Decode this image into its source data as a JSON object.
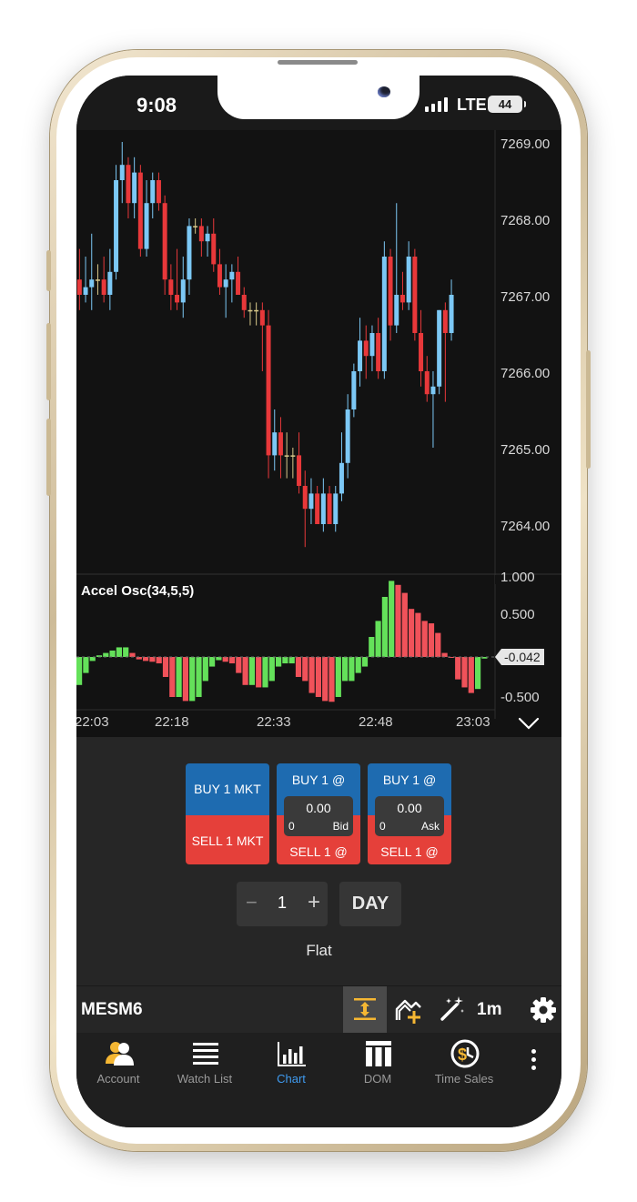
{
  "status_bar": {
    "time": "9:08",
    "network": "LTE",
    "battery": "44"
  },
  "chart": {
    "price_labels": [
      "7269.00",
      "7268.00",
      "7267.00",
      "7266.00",
      "7265.00",
      "7264.00"
    ],
    "oscillator": {
      "title": "Accel Osc(34,5,5)",
      "labels": [
        "1.000",
        "0.500",
        "-0.500"
      ],
      "current_value": "-0.042"
    },
    "time_labels": [
      "22:03",
      "22:18",
      "22:33",
      "22:48",
      "23:03"
    ],
    "colors": {
      "up": "#7cc8f5",
      "down": "#e8383a",
      "doji": "#d9c98a",
      "osc_up": "#64e15a",
      "osc_down": "#f0525a"
    },
    "chart_data": {
      "type": "candlestick",
      "title": "",
      "ylim": [
        7263.5,
        7269.2
      ],
      "candles": [
        [
          7267.2,
          7267.6,
          7266.8,
          7267.0
        ],
        [
          7267.0,
          7267.5,
          7266.9,
          7267.1
        ],
        [
          7267.1,
          7267.8,
          7266.8,
          7267.2
        ],
        [
          7267.2,
          7267.4,
          7267.0,
          7267.2
        ],
        [
          7267.2,
          7267.5,
          7266.9,
          7267.0
        ],
        [
          7267.0,
          7267.6,
          7266.8,
          7267.3
        ],
        [
          7267.3,
          7268.7,
          7267.2,
          7268.5
        ],
        [
          7268.5,
          7269.0,
          7268.2,
          7268.7
        ],
        [
          7268.7,
          7268.8,
          7268.0,
          7268.2
        ],
        [
          7268.2,
          7268.8,
          7268.0,
          7268.6
        ],
        [
          7268.6,
          7268.7,
          7267.5,
          7267.6
        ],
        [
          7267.6,
          7268.5,
          7267.5,
          7268.2
        ],
        [
          7268.2,
          7268.6,
          7268.0,
          7268.5
        ],
        [
          7268.5,
          7268.6,
          7268.1,
          7268.2
        ],
        [
          7268.2,
          7268.3,
          7267.0,
          7267.2
        ],
        [
          7267.2,
          7267.4,
          7266.8,
          7267.0
        ],
        [
          7267.0,
          7267.6,
          7266.8,
          7266.9
        ],
        [
          7266.9,
          7267.5,
          7266.7,
          7267.2
        ],
        [
          7267.2,
          7268.0,
          7267.0,
          7267.9
        ],
        [
          7267.9,
          7268.0,
          7267.8,
          7267.9
        ],
        [
          7267.9,
          7268.0,
          7267.5,
          7267.7
        ],
        [
          7267.7,
          7267.9,
          7267.5,
          7267.8
        ],
        [
          7267.8,
          7268.0,
          7267.3,
          7267.4
        ],
        [
          7267.4,
          7267.6,
          7267.0,
          7267.1
        ],
        [
          7267.1,
          7267.4,
          7266.7,
          7267.2
        ],
        [
          7267.2,
          7267.4,
          7266.9,
          7267.3
        ],
        [
          7267.3,
          7267.5,
          7267.0,
          7267.0
        ],
        [
          7267.0,
          7267.1,
          7266.7,
          7266.8
        ],
        [
          7266.8,
          7266.9,
          7266.6,
          7266.8
        ],
        [
          7266.8,
          7266.9,
          7266.6,
          7266.8
        ],
        [
          7266.8,
          7266.9,
          7266.0,
          7266.6
        ],
        [
          7266.6,
          7266.8,
          7264.6,
          7264.9
        ],
        [
          7264.9,
          7265.5,
          7264.7,
          7265.2
        ],
        [
          7265.2,
          7265.4,
          7264.6,
          7264.9
        ],
        [
          7264.9,
          7265.2,
          7264.6,
          7264.9
        ],
        [
          7264.9,
          7265.0,
          7264.6,
          7264.9
        ],
        [
          7264.9,
          7265.2,
          7264.4,
          7264.5
        ],
        [
          7264.5,
          7264.7,
          7263.7,
          7264.2
        ],
        [
          7264.2,
          7264.6,
          7264.0,
          7264.4
        ],
        [
          7264.4,
          7264.5,
          7264.0,
          7264.0
        ],
        [
          7264.0,
          7264.6,
          7263.9,
          7264.4
        ],
        [
          7264.4,
          7264.5,
          7264.0,
          7264.0
        ],
        [
          7264.0,
          7264.5,
          7263.9,
          7264.4
        ],
        [
          7264.4,
          7265.2,
          7264.3,
          7264.8
        ],
        [
          7264.8,
          7265.7,
          7264.6,
          7265.5
        ],
        [
          7265.5,
          7266.1,
          7265.4,
          7266.0
        ],
        [
          7266.0,
          7266.7,
          7265.8,
          7266.4
        ],
        [
          7266.4,
          7266.6,
          7265.9,
          7266.2
        ],
        [
          7266.2,
          7266.6,
          7266.0,
          7266.5
        ],
        [
          7266.5,
          7266.7,
          7265.9,
          7266.0
        ],
        [
          7266.0,
          7267.7,
          7265.9,
          7267.5
        ],
        [
          7267.5,
          7267.6,
          7266.4,
          7266.6
        ],
        [
          7266.6,
          7268.2,
          7266.5,
          7267.0
        ],
        [
          7267.0,
          7267.3,
          7266.8,
          7266.9
        ],
        [
          7266.9,
          7267.7,
          7266.8,
          7267.5
        ],
        [
          7267.5,
          7267.6,
          7266.4,
          7266.5
        ],
        [
          7266.5,
          7266.8,
          7265.8,
          7266.0
        ],
        [
          7266.0,
          7266.2,
          7265.6,
          7265.7
        ],
        [
          7265.7,
          7266.0,
          7265.0,
          7265.8
        ],
        [
          7265.8,
          7266.8,
          7265.7,
          7266.8
        ],
        [
          7266.8,
          7266.9,
          7265.6,
          7266.5
        ],
        [
          7266.5,
          7267.2,
          7266.4,
          7267.0
        ]
      ],
      "oscillator_values": [
        -0.35,
        -0.2,
        -0.05,
        0.02,
        0.05,
        0.08,
        0.12,
        0.12,
        0.05,
        -0.03,
        -0.05,
        -0.06,
        -0.08,
        -0.25,
        -0.5,
        -0.5,
        -0.55,
        -0.55,
        -0.5,
        -0.3,
        -0.12,
        -0.04,
        -0.06,
        -0.08,
        -0.2,
        -0.35,
        -0.35,
        -0.38,
        -0.38,
        -0.3,
        -0.12,
        -0.08,
        -0.08,
        -0.25,
        -0.3,
        -0.45,
        -0.5,
        -0.55,
        -0.56,
        -0.5,
        -0.3,
        -0.3,
        -0.2,
        -0.12,
        0.25,
        0.45,
        0.75,
        0.95,
        0.9,
        0.8,
        0.6,
        0.55,
        0.45,
        0.42,
        0.3,
        0.05,
        0.0,
        -0.28,
        -0.38,
        -0.45,
        -0.4,
        -0.02
      ]
    }
  },
  "trade_panel": {
    "buy_mkt": "BUY 1 MKT",
    "sell_mkt": "SELL 1 MKT",
    "bid_ticket": {
      "buy": "BUY 1 @",
      "sell": "SELL 1 @",
      "price": "0.00",
      "qty": "0",
      "type": "Bid"
    },
    "ask_ticket": {
      "buy": "BUY 1 @",
      "sell": "SELL 1 @",
      "price": "0.00",
      "qty": "0",
      "type": "Ask"
    },
    "quantity": "1",
    "duration": "DAY",
    "position": "Flat"
  },
  "toolbar": {
    "symbol": "MESM6",
    "interval": "1m"
  },
  "nav": {
    "items": [
      {
        "label": "Account",
        "icon": "account-icon"
      },
      {
        "label": "Watch List",
        "icon": "watchlist-icon"
      },
      {
        "label": "Chart",
        "icon": "chart-icon"
      },
      {
        "label": "DOM",
        "icon": "dom-icon"
      },
      {
        "label": "Time Sales",
        "icon": "time-sales-icon"
      }
    ],
    "active": "Chart"
  }
}
